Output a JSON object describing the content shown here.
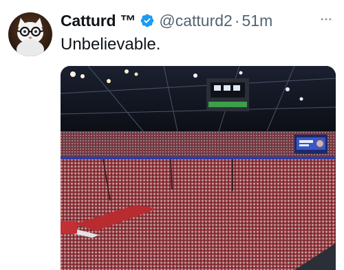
{
  "tweet": {
    "display_name": "Catturd ™",
    "handle": "@catturd2",
    "separator": "·",
    "time": "51m",
    "text": "Unbelievable.",
    "verified": true,
    "icons": {
      "verified": "verified-badge-icon",
      "more": "more-horizontal-icon"
    },
    "colors": {
      "verified_blue": "#1d9bf0",
      "secondary_text": "#536471",
      "primary_text": "#0f1419"
    }
  }
}
